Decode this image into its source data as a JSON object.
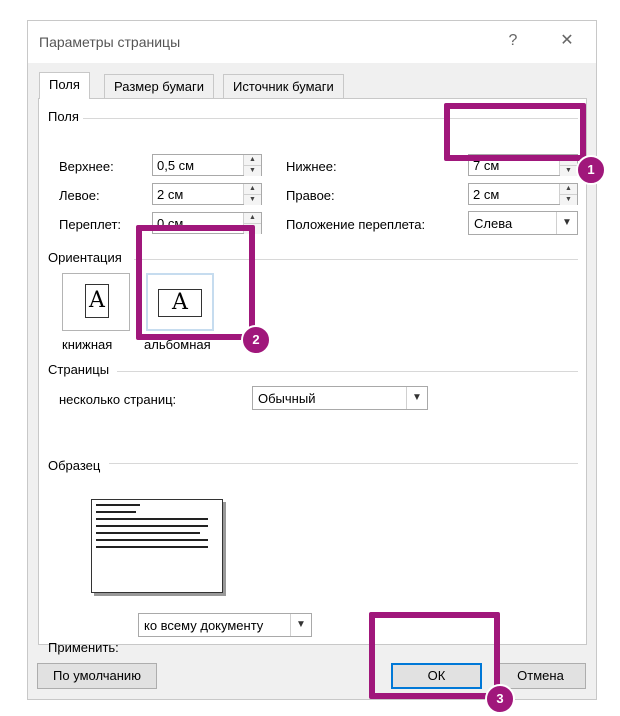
{
  "window": {
    "title": "Параметры страницы",
    "help": "?",
    "close": "✕"
  },
  "tabs": [
    {
      "label": "Поля"
    },
    {
      "label": "Размер бумаги"
    },
    {
      "label": "Источник бумаги"
    }
  ],
  "margins": {
    "group": "Поля",
    "top": {
      "label": "Верхнее:",
      "value": "0,5 см"
    },
    "left": {
      "label": "Левое:",
      "value": "2 см"
    },
    "gutter": {
      "label": "Переплет:",
      "value": "0 см"
    },
    "bottom": {
      "label": "Нижнее:",
      "value": "7 см"
    },
    "right": {
      "label": "Правое:",
      "value": "2 см"
    },
    "gutter_pos": {
      "label": "Положение переплета:",
      "value": "Слева"
    }
  },
  "orientation": {
    "group": "Ориентация",
    "portrait": "книжная",
    "landscape": "альбомная",
    "icon_letter": "A"
  },
  "pages": {
    "group": "Страницы",
    "label": "несколько страниц:",
    "value": "Обычный"
  },
  "preview": {
    "group": "Образец"
  },
  "apply": {
    "label": "Применить:",
    "value": "ко всему документу"
  },
  "buttons": {
    "default": "По умолчанию",
    "ok": "ОК",
    "cancel": "Отмена"
  },
  "annotations": {
    "b1": "1",
    "b2": "2",
    "b3": "3",
    "color": "#a0177b"
  }
}
